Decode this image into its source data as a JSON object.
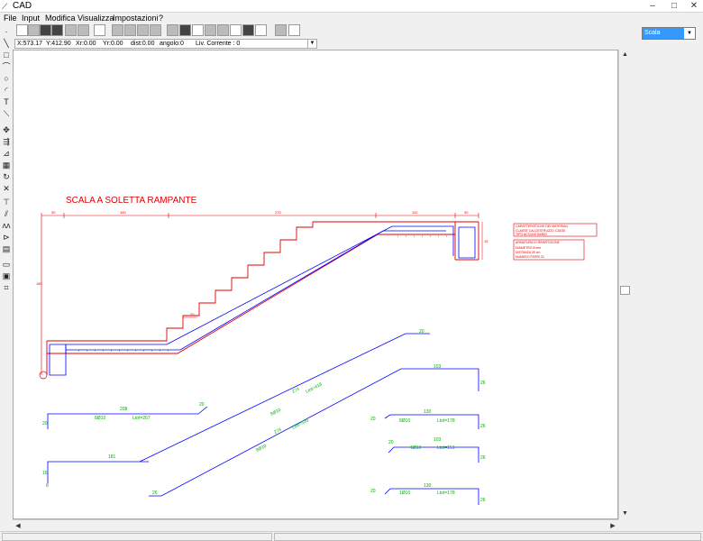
{
  "window": {
    "title": "CAD",
    "minimize": "–",
    "maximize": "□",
    "close": "✕"
  },
  "menu": [
    "File",
    "Input",
    "Modifica",
    "Visualizza",
    "Impostazioni",
    "?"
  ],
  "status_row": {
    "x": "X:573.17",
    "y": "Y:412.90",
    "xr": "Xr:0.00",
    "yr": "Yr:0.00",
    "dist": "dist:0.00",
    "angolo": "angolo:0",
    "livello": "Liv. Corrente : 0"
  },
  "right_panel": {
    "select_value": "Scala"
  },
  "drawing": {
    "title": "SCALA A SOLETTA RAMPANTE",
    "dims_top": [
      "30",
      "160",
      "270",
      "110",
      "30"
    ],
    "dim_left": "180",
    "dim_small": "20",
    "dim_right": "15",
    "materials_title": "CARATTERISTICHE DEI MATERIALI",
    "materials_1": "CLASSE CALCESTRUZZO  C25/30",
    "materials_2": "TIPO ACCIAIO  B450C",
    "arm_title": "ARMATURA DI RIPARTIZIONE",
    "arm_1": "DIAMETRO  8 mm",
    "arm_2": "DISTANZA  25 cm",
    "arm_3": "NUMERO FERRI  31",
    "bars": {
      "b1_len": "208",
      "b1_end": "20",
      "b1_hook": "20",
      "b1_label": "8Ø10",
      "b1_ltot": "Ltot=267",
      "b2_len": "181",
      "b2_hook": "15",
      "b2_label": "8Ø10",
      "diag1_len": "274",
      "diag1_ltot": "Ltot=418",
      "diag1_label": "8Ø10",
      "diag1_top": "20",
      "diag2_len": "274",
      "diag2_ltot": "Ltot=520",
      "diag2_label": "8Ø10",
      "diag2_hook": "26",
      "top_bar_len": "103",
      "top_bar_hook": "26",
      "r1_len": "130",
      "r1_hook_l": "20",
      "r1_hook_r": "26",
      "r1_label": "8Ø10",
      "r1_ltot": "Ltot=178",
      "r2_len": "103",
      "r2_hook_l": "20",
      "r2_hook_r": "26",
      "r2_label": "1Ø10",
      "r2_ltot": "Ltot=151",
      "r3_len": "130",
      "r3_hook_l": "20",
      "r3_hook_r": "26",
      "r3_label": "1Ø10",
      "r3_ltot": "Ltot=178"
    }
  }
}
